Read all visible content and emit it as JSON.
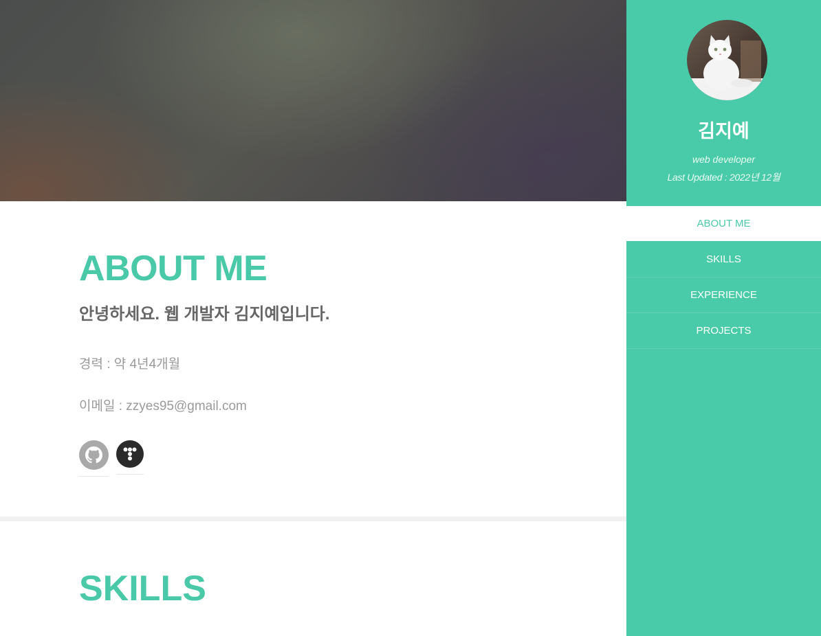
{
  "profile": {
    "name": "김지예",
    "role": "web developer",
    "updated": "Last Updated : 2022년 12월"
  },
  "nav": {
    "items": [
      {
        "label": "ABOUT ME",
        "active": true
      },
      {
        "label": "SKILLS",
        "active": false
      },
      {
        "label": "EXPERIENCE",
        "active": false
      },
      {
        "label": "PROJECTS",
        "active": false
      }
    ]
  },
  "about": {
    "title": "ABOUT ME",
    "intro": "안녕하세요. 웹 개발자 김지예입니다.",
    "career": "경력 : 약 4년4개월",
    "email": "이메일 : zzyes95@gmail.com",
    "links": [
      {
        "icon": "github-icon"
      },
      {
        "icon": "tistory-icon"
      }
    ]
  },
  "skills": {
    "title": "SKILLS"
  },
  "colors": {
    "accent": "#49c9a8",
    "sidebar": "#49cba9",
    "text_muted": "#9a9a9a",
    "text_dark": "#666666"
  }
}
